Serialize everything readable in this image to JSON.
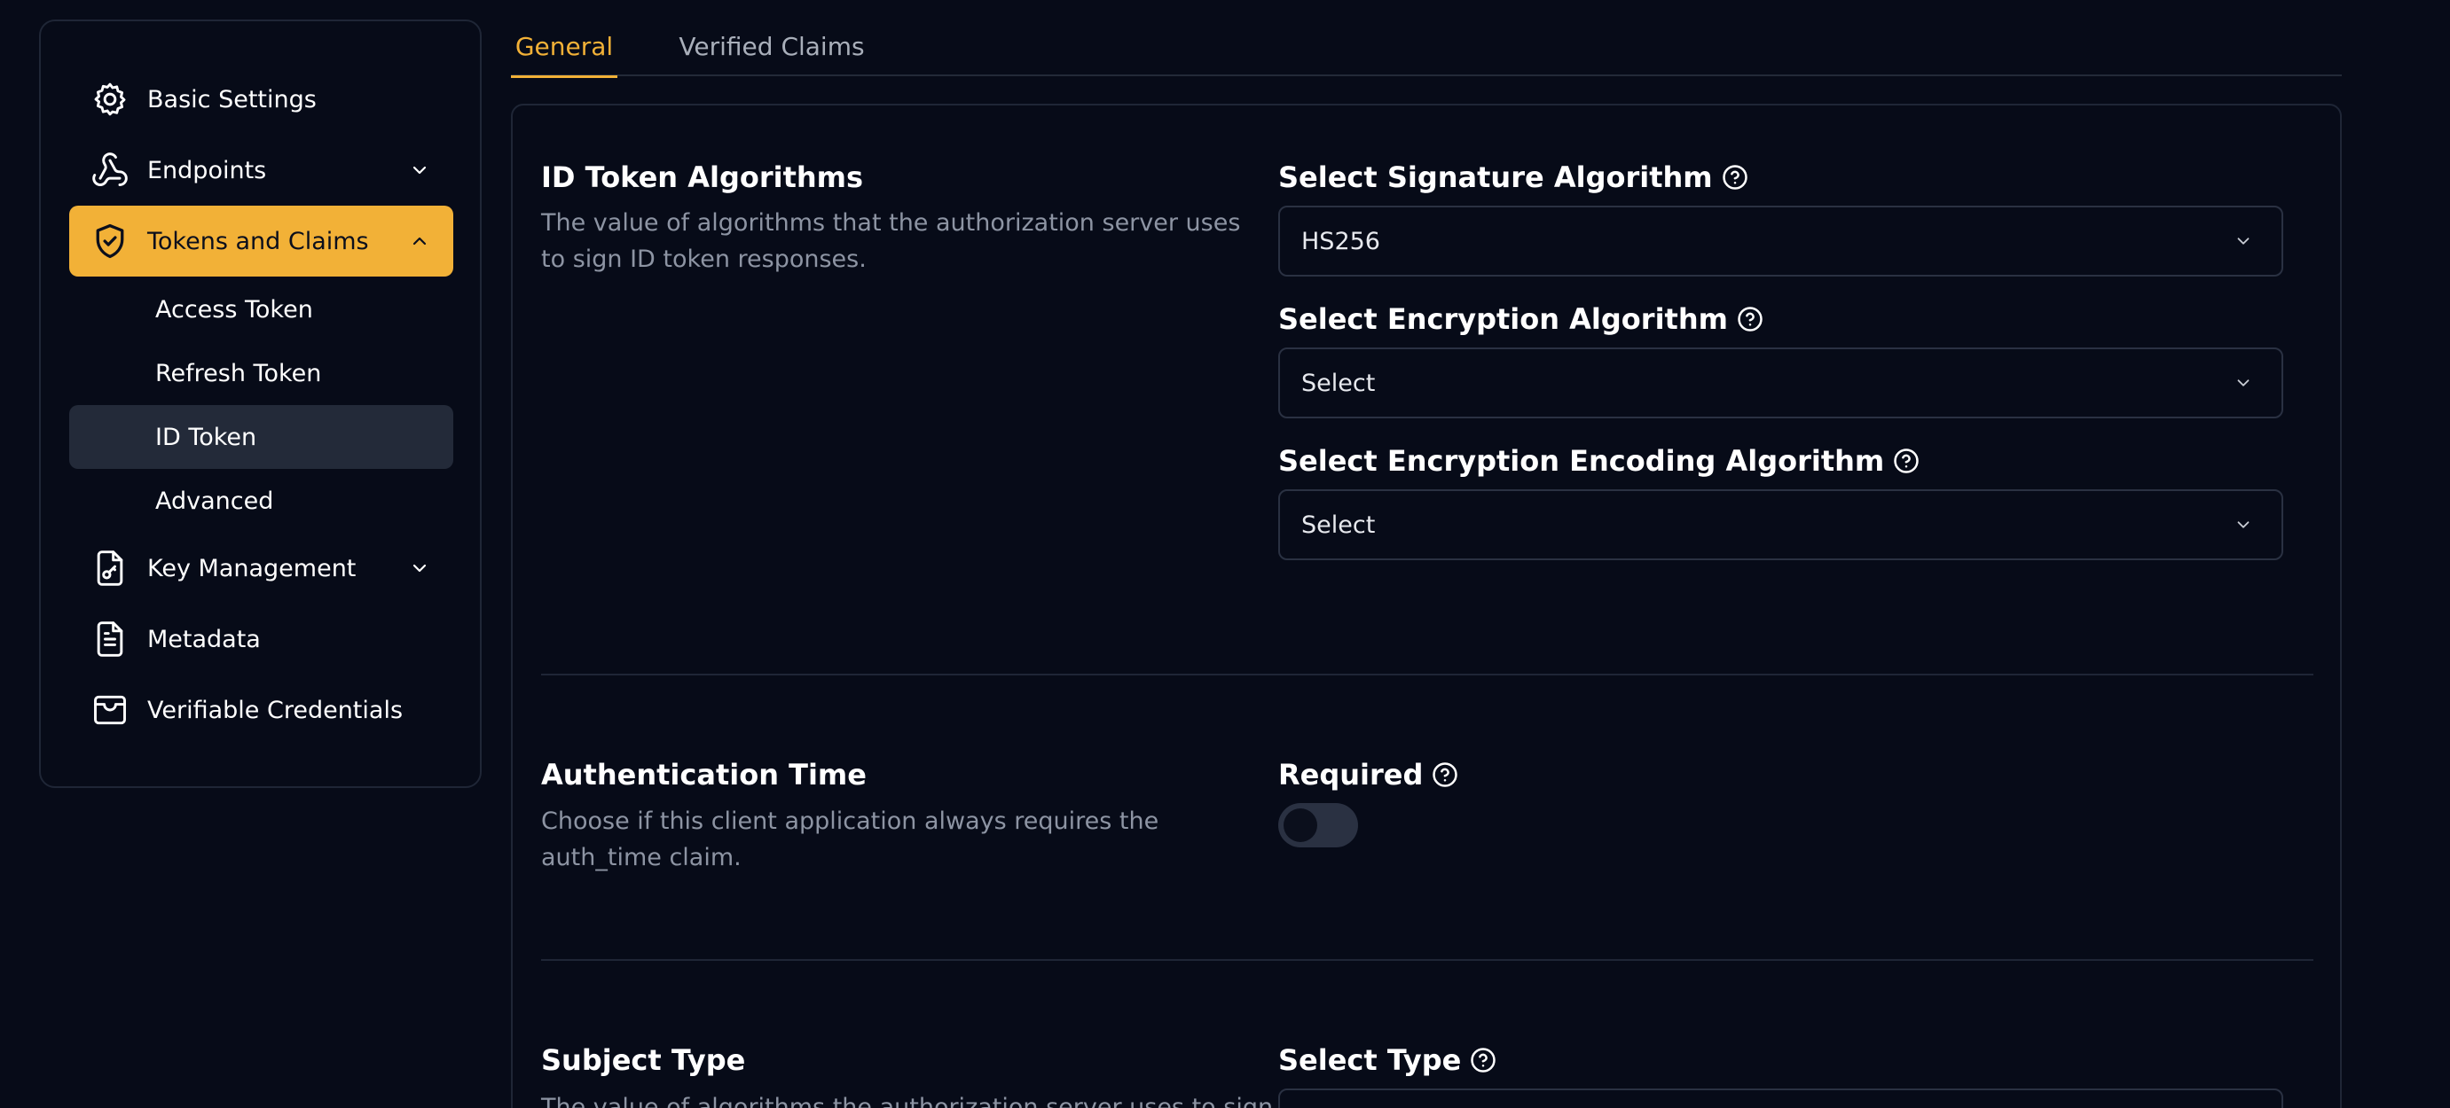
{
  "tabs": [
    {
      "label": "General",
      "active": true
    },
    {
      "label": "Verified Claims",
      "active": false
    }
  ],
  "sidebar": {
    "items": [
      {
        "label": "Basic Settings",
        "icon": "gear-icon"
      },
      {
        "label": "Endpoints",
        "icon": "webhook-icon",
        "expandable": true
      },
      {
        "label": "Tokens and Claims",
        "icon": "shield-icon",
        "expandable": true,
        "active": true
      },
      {
        "label": "Key Management",
        "icon": "file-key-icon",
        "expandable": true
      },
      {
        "label": "Metadata",
        "icon": "document-icon"
      },
      {
        "label": "Verifiable Credentials",
        "icon": "wallet-icon"
      }
    ],
    "sub_items": [
      {
        "label": "Access Token"
      },
      {
        "label": "Refresh Token"
      },
      {
        "label": "ID Token",
        "selected": true
      },
      {
        "label": "Advanced"
      }
    ]
  },
  "sections": {
    "id_token": {
      "title": "ID Token Algorithms",
      "description": "The value of algorithms that the authorization server uses to sign ID token responses.",
      "fields": [
        {
          "label": "Select Signature Algorithm",
          "value": "HS256"
        },
        {
          "label": "Select Encryption Algorithm",
          "value": "Select"
        },
        {
          "label": "Select Encryption Encoding Algorithm",
          "value": "Select"
        }
      ]
    },
    "auth_time": {
      "title": "Authentication Time",
      "description": "Choose if this client application always requires the auth_time claim.",
      "toggle_label": "Required",
      "toggle_on": false
    },
    "subject_type": {
      "title": "Subject Type",
      "description": "The value of algorithms the authorization server uses to sign",
      "field_label": "Select Type"
    }
  },
  "colors": {
    "background": "#070b18",
    "accent": "#f2b137",
    "border": "#1f2636",
    "selected_item": "#232a39",
    "muted_text": "#8d94a3"
  }
}
